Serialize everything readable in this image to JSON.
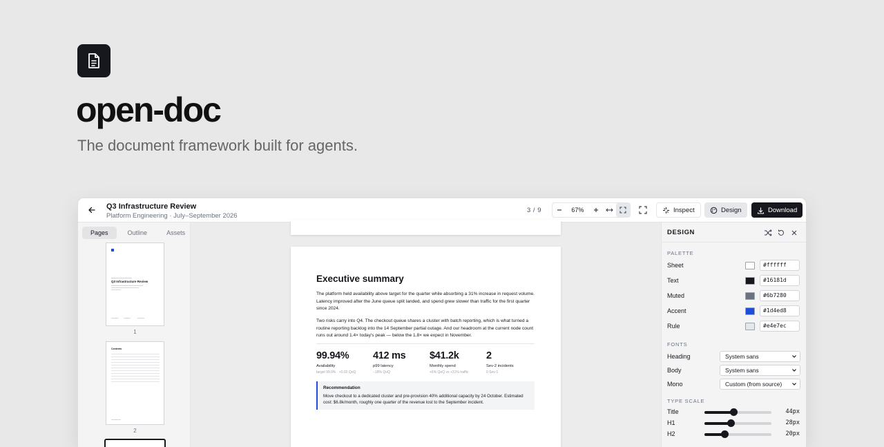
{
  "hero": {
    "title": "open-doc",
    "tagline": "The document framework built for agents.",
    "logo_icon": "document-icon"
  },
  "topbar": {
    "doc_title": "Q3 Infrastructure Review",
    "doc_subtitle": "Platform Engineering · July–September 2026",
    "page_indicator": "3 / 9",
    "zoom": "67%",
    "inspect_label": "Inspect",
    "design_label": "Design",
    "download_label": "Download"
  },
  "left_panel": {
    "tabs": [
      "Pages",
      "Outline",
      "Assets"
    ],
    "active_tab": "Pages",
    "thumbnails": [
      {
        "number": "1",
        "heading": "Q3 Infrastructure Review"
      },
      {
        "number": "2",
        "heading": "Contents"
      }
    ]
  },
  "page": {
    "heading": "Executive summary",
    "para1": "The platform held availability above target for the quarter while absorbing a 31% increase in request volume. Latency improved after the June queue split landed, and spend grew slower than traffic for the first quarter since 2024.",
    "para2": "Two risks carry into Q4. The checkout queue shares a cluster with batch reporting, which is what turned a routine reporting backlog into the 14 September partial outage. And our headroom at the current node count runs out around 1.4× today's peak — below the 1.8× we expect in November.",
    "metrics": [
      {
        "value": "99.94%",
        "label": "Availability",
        "note": "target 99.9% · +0.02 QoQ"
      },
      {
        "value": "412 ms",
        "label": "p99 latency",
        "note": "−18% QoQ"
      },
      {
        "value": "$41.2k",
        "label": "Monthly spend",
        "note": "+6% QoQ vs +31% traffic"
      },
      {
        "value": "2",
        "label": "Sev-2 incidents",
        "note": "0 Sev-1"
      }
    ],
    "callout": {
      "title": "Recommendation",
      "body": "Move checkout to a dedicated cluster and pre-provision 40% additional capacity by 24 October. Estimated cost: $6.8k/month, roughly one quarter of the revenue lost to the September incident."
    }
  },
  "design_panel": {
    "title": "DESIGN",
    "palette_label": "PALETTE",
    "palette": [
      {
        "name": "Sheet",
        "hex": "#ffffff"
      },
      {
        "name": "Text",
        "hex": "#16181d"
      },
      {
        "name": "Muted",
        "hex": "#6b7280"
      },
      {
        "name": "Accent",
        "hex": "#1d4ed8"
      },
      {
        "name": "Rule",
        "hex": "#e4e7ec"
      }
    ],
    "fonts_label": "FONTS",
    "fonts": [
      {
        "name": "Heading",
        "value": "System sans"
      },
      {
        "name": "Body",
        "value": "System sans"
      },
      {
        "name": "Mono",
        "value": "Custom (from source)"
      }
    ],
    "type_scale_label": "TYPE SCALE",
    "type_scale": [
      {
        "name": "Title",
        "value": "44px",
        "level": 0.43
      },
      {
        "name": "H1",
        "value": "28px",
        "level": 0.39
      },
      {
        "name": "H2",
        "value": "20px",
        "level": 0.3
      }
    ]
  }
}
